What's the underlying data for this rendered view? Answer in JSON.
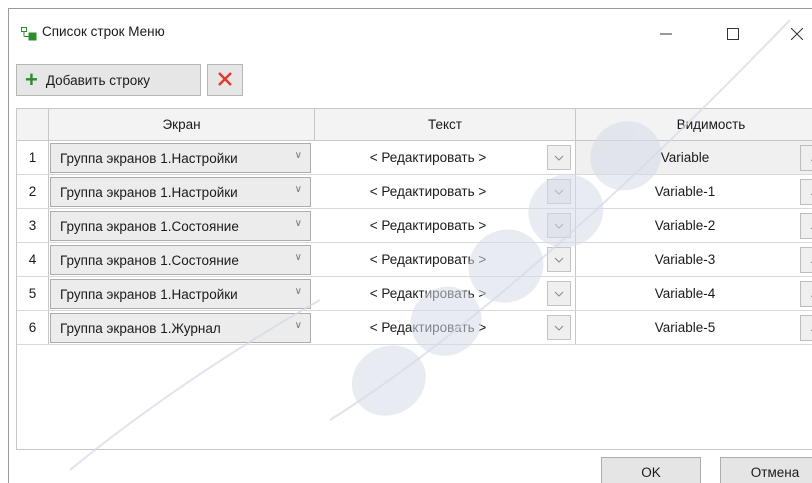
{
  "window": {
    "title": "Список строк Меню",
    "icon": "menu-list-icon",
    "controls": {
      "minimize_icon": "minimize-icon",
      "maximize_icon": "maximize-icon",
      "close_icon": "close-icon"
    }
  },
  "toolbar": {
    "add_label": "Добавить строку",
    "add_icon": "plus-icon",
    "delete_icon": "delete-x-icon"
  },
  "grid": {
    "columns": [
      "Экран",
      "Текст",
      "Видимость"
    ],
    "rows": [
      {
        "num": "1",
        "screen": "Группа экранов 1.Настройки",
        "text": "< Редактировать >",
        "visibility": "Variable",
        "selected": true
      },
      {
        "num": "2",
        "screen": "Группа экранов 1.Настройки",
        "text": "< Редактировать >",
        "visibility": "Variable-1",
        "selected": false
      },
      {
        "num": "3",
        "screen": "Группа экранов 1.Состояние",
        "text": "< Редактировать >",
        "visibility": "Variable-2",
        "selected": false
      },
      {
        "num": "4",
        "screen": "Группа экранов 1.Состояние",
        "text": "< Редактировать >",
        "visibility": "Variable-3",
        "selected": false
      },
      {
        "num": "5",
        "screen": "Группа экранов 1.Настройки",
        "text": "< Редактировать >",
        "visibility": "Variable-4",
        "selected": false
      },
      {
        "num": "6",
        "screen": "Группа экранов 1.Журнал",
        "text": "< Редактировать >",
        "visibility": "Variable-5",
        "selected": false
      }
    ],
    "ellipsis": "..."
  },
  "footer": {
    "ok_label": "OK",
    "cancel_label": "Отмена"
  },
  "colors": {
    "add_green": "#2e8b2e",
    "delete_red": "#e03a2e",
    "watermark": "#d6dbe8"
  }
}
